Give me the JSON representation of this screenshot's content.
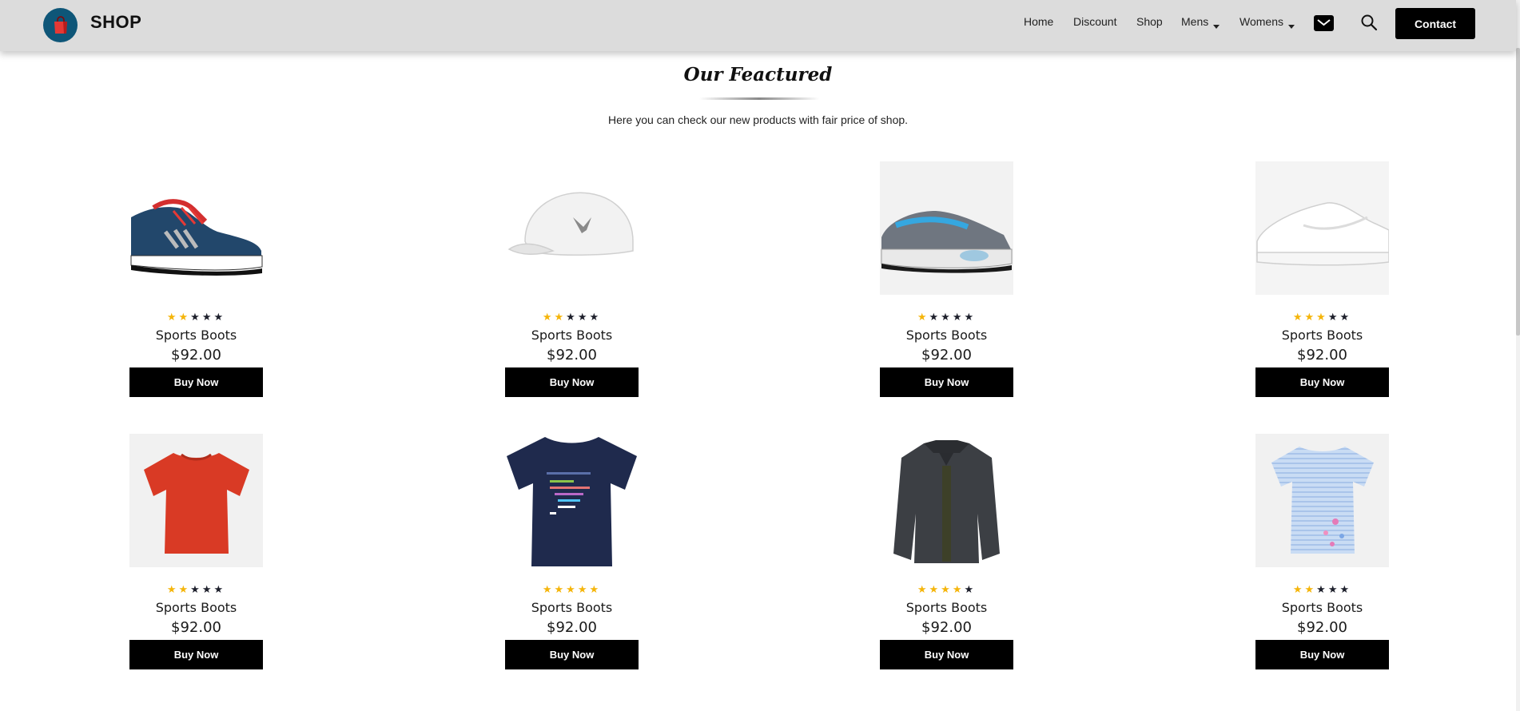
{
  "navbar": {
    "brand": "SHOP",
    "links": [
      {
        "label": "Home"
      },
      {
        "label": "Discount"
      },
      {
        "label": "Shop"
      },
      {
        "label": "Mens"
      },
      {
        "label": "Womens"
      }
    ],
    "contact_label": "Contact",
    "icons": {
      "logo": "shopping-bag-icon",
      "mail": "mail-icon",
      "search": "search-icon"
    },
    "colors": {
      "bar": "#dcdcdc",
      "logo_bg": "#0e5678",
      "bag": "#e53935"
    }
  },
  "section": {
    "title": "Our Feactured",
    "subtitle": "Here you can check our new products with fair price of shop."
  },
  "products": [
    {
      "image": "blue-sneaker",
      "rating": 2,
      "name": "Sports Boots",
      "price": "$92.00",
      "button": "Buy Now"
    },
    {
      "image": "white-cap",
      "rating": 2,
      "name": "Sports Boots",
      "price": "$92.00",
      "button": "Buy Now"
    },
    {
      "image": "grey-air-sneaker",
      "rating": 1,
      "name": "Sports Boots",
      "price": "$92.00",
      "button": "Buy Now"
    },
    {
      "image": "white-sneaker",
      "rating": 3,
      "name": "Sports Boots",
      "price": "$92.00",
      "button": "Buy Now"
    },
    {
      "image": "red-tshirt",
      "rating": 2,
      "name": "Sports Boots",
      "price": "$92.00",
      "button": "Buy Now"
    },
    {
      "image": "navy-code-tshirt",
      "rating": 5,
      "name": "Sports Boots",
      "price": "$92.00",
      "button": "Buy Now"
    },
    {
      "image": "black-jacket",
      "rating": 4,
      "name": "Sports Boots",
      "price": "$92.00",
      "button": "Buy Now"
    },
    {
      "image": "striped-kids-tshirt",
      "rating": 2,
      "name": "Sports Boots",
      "price": "$92.00",
      "button": "Buy Now"
    }
  ],
  "rating_max": 5,
  "colors": {
    "star_on": "#f5b50a",
    "star_off": "#1d1f2b",
    "button": "#000000",
    "button_text": "#ffffff"
  }
}
